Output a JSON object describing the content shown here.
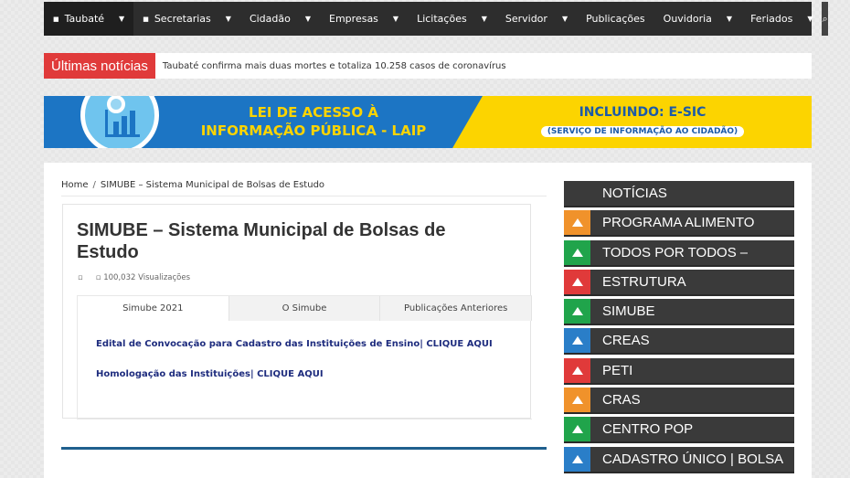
{
  "nav": {
    "items": [
      {
        "label": "Taubaté",
        "has_dropdown": true
      },
      {
        "label": "Secretarias",
        "has_dropdown": true
      },
      {
        "label": "Cidadão",
        "has_dropdown": true
      },
      {
        "label": "Empresas",
        "has_dropdown": true
      },
      {
        "label": "Licitações",
        "has_dropdown": true
      },
      {
        "label": "Servidor",
        "has_dropdown": true
      },
      {
        "label": "Publicações",
        "has_dropdown": false
      },
      {
        "label": "Ouvidoria",
        "has_dropdown": true
      },
      {
        "label": "Feriados",
        "has_dropdown": true
      }
    ],
    "search_icon": "search-icon"
  },
  "ticker": {
    "label": "Últimas notícias",
    "text": "Taubaté confirma mais duas mortes e totaliza 10.258 casos de coronavírus"
  },
  "banner": {
    "line1": "LEI DE ACESSO À",
    "line2": "INFORMAÇÃO PÚBLICA - LAIP",
    "right_title": "INCLUINDO: E-SIC",
    "right_sub": "(SERVIÇO DE INFORMAÇÃO AO CIDADÃO)"
  },
  "breadcrumb": {
    "home": "Home",
    "current": "SIMUBE – Sistema Municipal de Bolsas de Estudo"
  },
  "article": {
    "title": "SIMUBE – Sistema Municipal de Bolsas de Estudo",
    "views": "100,032 Visualizações",
    "tabs": [
      "Simube 2021",
      "O Simube",
      "Publicações Anteriores"
    ],
    "active_tab": 0,
    "links": [
      "Edital de Convocação para Cadastro das Instituições de Ensino| CLIQUE AQUI",
      "Homologação das Instituições| CLIQUE AQUI"
    ]
  },
  "sidebar": {
    "items": [
      {
        "label": "NOTÍCIAS",
        "color": ""
      },
      {
        "label": "PROGRAMA ALIMENTO",
        "color": "#f0922b"
      },
      {
        "label": "TODOS POR TODOS –",
        "color": "#20a44b"
      },
      {
        "label": "ESTRUTURA",
        "color": "#e03a3a"
      },
      {
        "label": "SIMUBE",
        "color": "#20a44b"
      },
      {
        "label": "CREAS",
        "color": "#2a7ec8"
      },
      {
        "label": "PETI",
        "color": "#e03a3a"
      },
      {
        "label": "CRAS",
        "color": "#f0922b"
      },
      {
        "label": "CENTRO POP",
        "color": "#20a44b"
      },
      {
        "label": "CADASTRO ÚNICO | BOLSA",
        "color": "#2a7ec8"
      }
    ]
  }
}
